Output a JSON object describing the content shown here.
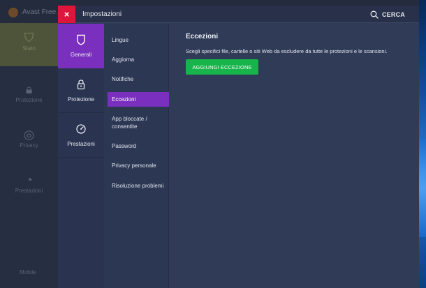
{
  "background_app": {
    "name": "Avast Free A",
    "nav": [
      {
        "label": "Stato",
        "icon": "shield-icon"
      },
      {
        "label": "Protezione",
        "icon": "lock-icon"
      },
      {
        "label": "Privacy",
        "icon": "fingerprint-icon"
      },
      {
        "label": "Prestazioni",
        "icon": "speedometer-icon"
      }
    ],
    "bottom_label": "Mobile"
  },
  "settings": {
    "title": "Impostazioni",
    "close_label": "×",
    "search_label": "CERCA",
    "categories": [
      {
        "label": "Generali",
        "icon": "shield-icon",
        "active": true
      },
      {
        "label": "Protezione",
        "icon": "lock-icon",
        "active": false
      },
      {
        "label": "Prestazioni",
        "icon": "speedometer-icon",
        "active": false
      }
    ],
    "submenu": [
      {
        "label": "Lingue"
      },
      {
        "label": "Aggiorna"
      },
      {
        "label": "Notifiche"
      },
      {
        "label": "Eccezioni",
        "active": true
      },
      {
        "label": "App bloccate / consentite"
      },
      {
        "label": "Password"
      },
      {
        "label": "Privacy personale"
      },
      {
        "label": "Risoluzione problemi"
      }
    ],
    "content": {
      "title": "Eccezioni",
      "description": "Scegli specifici file, cartelle o siti Web da escludere da tutte le protezioni e le scansioni.",
      "add_button": "AGGIUNGI ECCEZIONE"
    }
  },
  "colors": {
    "accent": "#7b2fbf",
    "close": "#e0153a",
    "primary_button": "#16b44b",
    "panel": "#2f3b57"
  }
}
